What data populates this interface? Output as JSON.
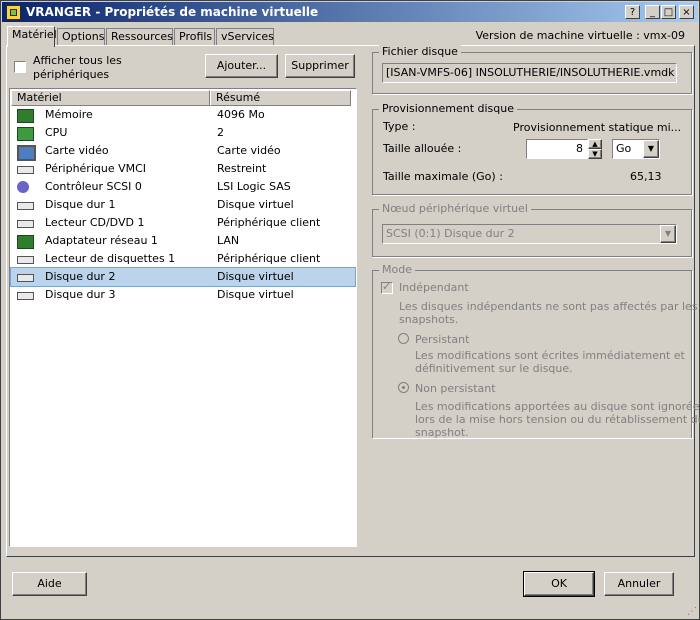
{
  "window": {
    "title": "VRANGER - Propriétés de machine virtuelle"
  },
  "titlebar_buttons": {
    "help": "?",
    "minimize": "_",
    "maximize": "□",
    "close": "×"
  },
  "tabs": [
    {
      "label": "Matériel"
    },
    {
      "label": "Options"
    },
    {
      "label": "Ressources"
    },
    {
      "label": "Profils"
    },
    {
      "label": "vServices"
    }
  ],
  "version": "Version de machine virtuelle : vmx-09",
  "show_all": {
    "label_line1": "Afficher tous les",
    "label_line2": "périphériques",
    "checked": false
  },
  "buttons": {
    "add": "Ajouter...",
    "remove": "Supprimer",
    "help": "Aide",
    "ok": "OK",
    "cancel": "Annuler"
  },
  "hardware": {
    "columns": [
      "Matériel",
      "Résumé"
    ],
    "rows": [
      {
        "name": "Mémoire",
        "summary": "4096 Mo",
        "icon": "memory-icon"
      },
      {
        "name": "CPU",
        "summary": "2",
        "icon": "cpu-icon"
      },
      {
        "name": "Carte vidéo",
        "summary": "Carte vidéo",
        "icon": "monitor-icon"
      },
      {
        "name": "Périphérique VMCI",
        "summary": "Restreint",
        "icon": "vmci-icon"
      },
      {
        "name": "Contrôleur SCSI 0",
        "summary": "LSI Logic SAS",
        "icon": "scsi-icon"
      },
      {
        "name": "Disque dur 1",
        "summary": "Disque virtuel",
        "icon": "disk-icon"
      },
      {
        "name": "Lecteur CD/DVD 1",
        "summary": "Périphérique client",
        "icon": "cdrom-icon"
      },
      {
        "name": "Adaptateur réseau 1",
        "summary": "LAN",
        "icon": "network-icon"
      },
      {
        "name": "Lecteur de disquettes 1",
        "summary": "Périphérique client",
        "icon": "floppy-icon"
      },
      {
        "name": "Disque dur 2",
        "summary": "Disque virtuel",
        "icon": "disk-icon"
      },
      {
        "name": "Disque dur 3",
        "summary": "Disque virtuel",
        "icon": "disk-icon"
      }
    ],
    "selected_index": 9
  },
  "disk_file": {
    "group_label": "Fichier disque",
    "value": "[ISAN-VMFS-06] INSOLUTHERIE/INSOLUTHERIE.vmdk"
  },
  "provisioning": {
    "group_label": "Provisionnement disque",
    "type_label": "Type :",
    "type_value": "Provisionnement statique mi...",
    "size_label": "Taille allouée :",
    "size_value": "8",
    "size_unit": "Go",
    "max_label": "Taille maximale (Go) :",
    "max_value": "65,13"
  },
  "virtual_node": {
    "group_label": "Nœud périphérique virtuel",
    "value": "SCSI (0:1) Disque dur 2"
  },
  "mode": {
    "group_label": "Mode",
    "independent_label": "Indépendant",
    "independent_desc_1": "Les disques indépendants ne sont pas affectés par les",
    "independent_desc_2": "snapshots.",
    "persistent_label": "Persistant",
    "persistent_desc_1": "Les modifications sont écrites immédiatement et",
    "persistent_desc_2": "définitivement sur le disque.",
    "nonpersistent_label": "Non persistant",
    "nonpersistent_desc_1": "Les modifications apportées au disque sont ignorées",
    "nonpersistent_desc_2": "lors de la mise hors tension ou du rétablissement du",
    "nonpersistent_desc_3": "snapshot."
  }
}
